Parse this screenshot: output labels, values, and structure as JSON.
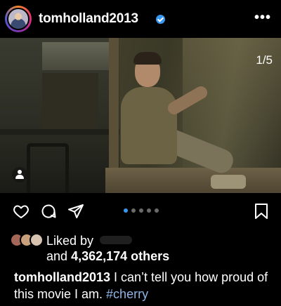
{
  "post": {
    "username": "tomholland2013",
    "verified": true,
    "carousel_counter": "1/5",
    "carousel": {
      "total": 5,
      "active_index": 0
    }
  },
  "icons": {
    "more": "more-horizontal-icon",
    "like": "heart-outline-icon",
    "comment": "comment-bubble-icon",
    "share": "paper-plane-icon",
    "save": "bookmark-icon",
    "tag": "user-tag-icon",
    "verified": "verified-badge-icon"
  },
  "likes": {
    "liked_by_label": "Liked by",
    "and_label": "and",
    "count": "4,362,174",
    "others_label": "others"
  },
  "caption": {
    "username": "tomholland2013",
    "text": " I can’t tell you how proud of this movie I am. ",
    "hashtag": "#cherry"
  },
  "colors": {
    "background": "#000000",
    "verified": "#3897f0",
    "hashtag": "#8fb4e6",
    "active_dot": "#3897f0"
  }
}
